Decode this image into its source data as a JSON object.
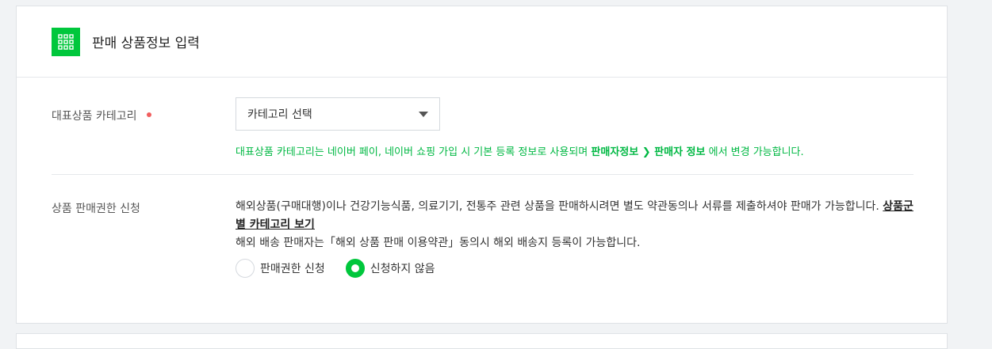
{
  "header": {
    "title": "판매 상품정보 입력",
    "icon": "grid-icon",
    "accent": "#00c73c"
  },
  "category": {
    "label": "대표상품 카테고리",
    "select_value": "카테고리 선택",
    "help_prefix": "대표상품 카테고리는 네이버 페이, 네이버 쇼핑 가입 시 기본 등록 정보로 사용되며 ",
    "help_bold": "판매자정보 ❯ 판매자 정보",
    "help_suffix": " 에서 변경 가능합니다."
  },
  "permission": {
    "label": "상품 판매권한 신청",
    "desc_line1": "해외상품(구매대행)이나 건강기능식품, 의료기기, 전통주 관련 상품을 판매하시려면 별도 약관동의나 서류를 제출하셔야 판매가 가능합니다. ",
    "desc_link": "상품군별 카테고리 보기",
    "desc_line2": "해외 배송 판매자는「해외 상품 판매 이용약관」동의시 해외 배송지 등록이 가능합니다.",
    "options": [
      {
        "label": "판매권한 신청",
        "selected": false
      },
      {
        "label": "신청하지 않음",
        "selected": true
      }
    ]
  }
}
